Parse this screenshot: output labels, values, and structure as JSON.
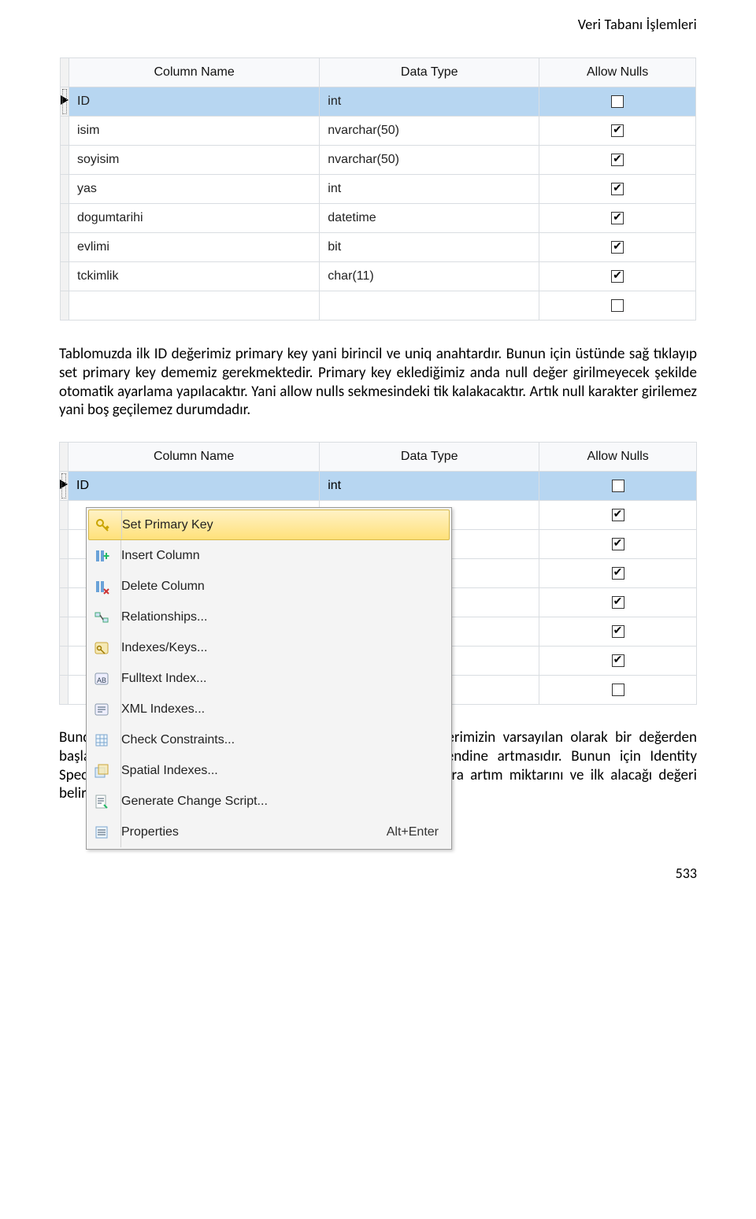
{
  "header_title": "Veri Tabanı İşlemleri",
  "table1": {
    "headers": {
      "col_name": "Column Name",
      "data_type": "Data Type",
      "allow_nulls": "Allow Nulls"
    },
    "rows": [
      {
        "name": "ID",
        "type": "int",
        "allow_nulls": false,
        "selected": true,
        "pointer": true
      },
      {
        "name": "isim",
        "type": "nvarchar(50)",
        "allow_nulls": true
      },
      {
        "name": "soyisim",
        "type": "nvarchar(50)",
        "allow_nulls": true
      },
      {
        "name": "yas",
        "type": "int",
        "allow_nulls": true
      },
      {
        "name": "dogumtarihi",
        "type": "datetime",
        "allow_nulls": true
      },
      {
        "name": "evlimi",
        "type": "bit",
        "allow_nulls": true
      },
      {
        "name": "tckimlik",
        "type": "char(11)",
        "allow_nulls": true
      },
      {
        "name": "",
        "type": "",
        "allow_nulls": false,
        "empty": true
      }
    ]
  },
  "paragraph1": "Tablomuzda ilk ID değerimiz primary key yani birincil ve uniq anahtardır. Bunun için üstünde sağ tıklayıp set primary key dememiz gerekmektedir. Primary key eklediğimiz anda null değer girilmeyecek şekilde otomatik ayarlama yapılacaktır. Yani allow nulls sekmesindeki tik kalakacaktır. Artık null karakter girilemez yani boş geçilemez durumdadır.",
  "table2": {
    "headers": {
      "col_name": "Column Name",
      "data_type": "Data Type",
      "allow_nulls": "Allow Nulls"
    },
    "row_preview": {
      "name": "ID",
      "type": "int"
    },
    "nulls_checks": [
      false,
      true,
      true,
      true,
      true,
      true,
      true,
      false
    ]
  },
  "context_menu": {
    "items": [
      {
        "label": "Set Primary Key",
        "icon": "key-icon",
        "selected": true
      },
      {
        "label": "Insert Column",
        "icon": "insert-col-icon"
      },
      {
        "label": "Delete Column",
        "icon": "delete-col-icon"
      },
      {
        "label": "Relationships...",
        "icon": "relationships-icon"
      },
      {
        "label": "Indexes/Keys...",
        "icon": "key-badge-icon"
      },
      {
        "label": "Fulltext Index...",
        "icon": "fulltext-icon"
      },
      {
        "label": "XML Indexes...",
        "icon": "xml-index-icon"
      },
      {
        "label": "Check Constraints...",
        "icon": "grid-icon"
      },
      {
        "label": "Spatial Indexes...",
        "icon": "spatial-icon"
      },
      {
        "label": "Generate Change Script...",
        "icon": "script-icon"
      },
      {
        "label": "Properties",
        "icon": "properties-icon",
        "shortcut": "Alt+Enter"
      }
    ]
  },
  "paragraph2": "Bundan sonra yapmamız gereken ikin ayar primary key değerimizin varsayılan olarak bir değerden başlayıp belirlediğimiz artış miktarı ile her kayıtta kendi kendine artmasıdır. Bunun için Identity Specification kısmından Is Identity özelliğine Yes dedikten sonra artım miktarını ve ilk alacağı değeri belirleyebiliyoruz.",
  "page_number": "533"
}
